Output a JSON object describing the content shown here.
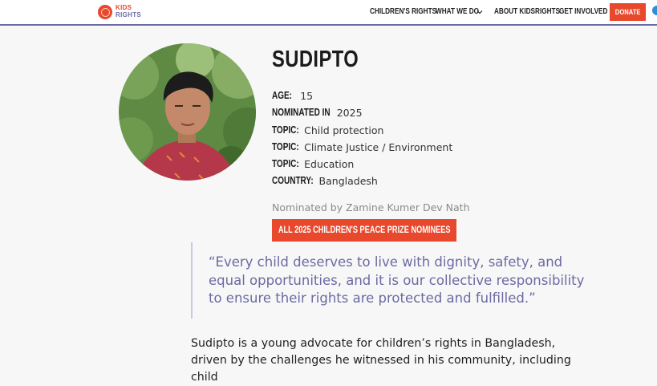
{
  "logo": {
    "line1": "KIDS",
    "line2": "RIGHTS"
  },
  "nav": {
    "items": [
      {
        "label": "CHILDREN'S RIGHTS"
      },
      {
        "label": "WHAT WE DO"
      },
      {
        "label": "ABOUT KIDSRIGHTS"
      },
      {
        "label": "GET INVOLVED"
      }
    ],
    "donate_label": "DONATE"
  },
  "profile": {
    "name": "SUDIPTO",
    "details": [
      {
        "label": "AGE:",
        "value": "15"
      },
      {
        "label": "NOMINATED IN",
        "value": "2025"
      },
      {
        "label": "TOPIC:",
        "value": "Child protection"
      },
      {
        "label": "TOPIC:",
        "value": "Climate Justice / Environment"
      },
      {
        "label": "TOPIC:",
        "value": "Education"
      },
      {
        "label": "COUNTRY:",
        "value": "Bangladesh"
      }
    ],
    "nominated_by": "Nominated by Zamine Kumer Dev Nath",
    "nominees_button": "ALL 2025 CHILDREN'S PEACE PRIZE NOMINEES"
  },
  "quote": "“Every child deserves to live with dignity, safety, and equal opportunities, and it is our collective responsibility to ensure their rights are protected and fulfilled.”",
  "body": "Sudipto is a young advocate for children’s rights in Bangladesh, driven by the challenges he witnessed in his community, including child",
  "colors": {
    "accent": "#e8482c",
    "purple": "#6b6aa3"
  },
  "icons": {
    "dropdown": "chevron-down-icon",
    "logo": "kidsrights-logo"
  }
}
